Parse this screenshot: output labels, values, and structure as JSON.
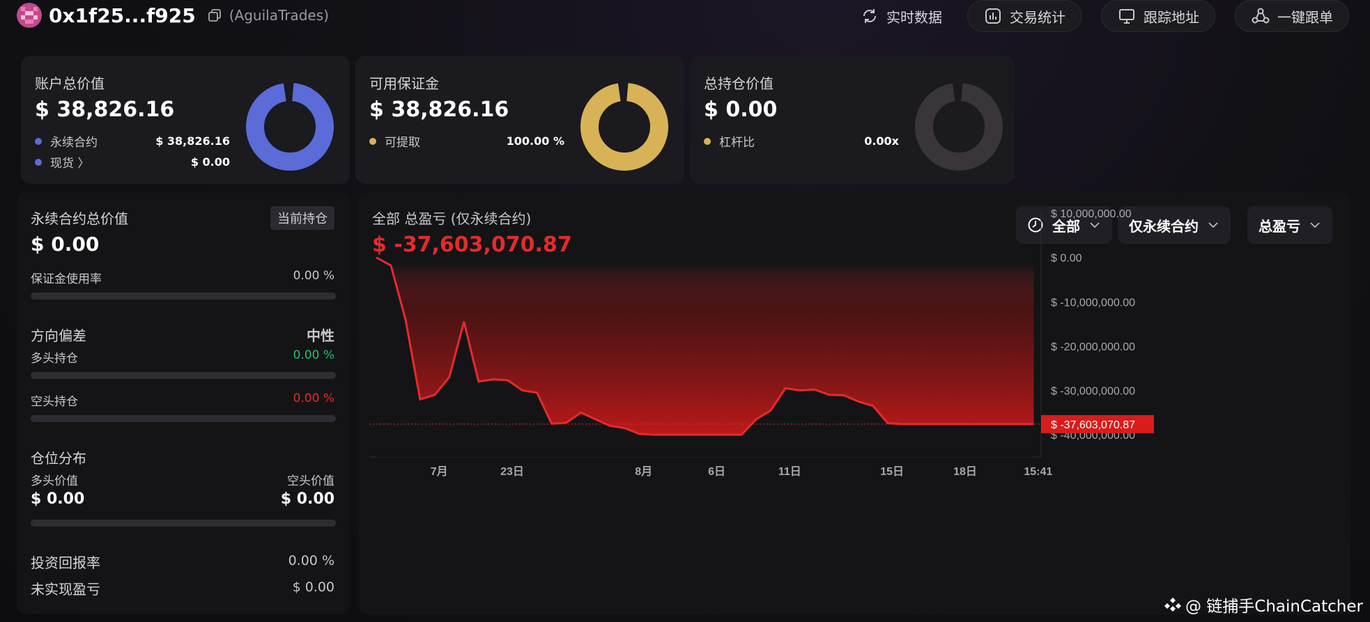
{
  "header": {
    "address": "0x1f25...f925",
    "alias": "(AguilaTrades)",
    "buttons": [
      {
        "label": "实时数据",
        "icon": "refresh-icon"
      },
      {
        "label": "交易统计",
        "icon": "stats-icon"
      },
      {
        "label": "跟踪地址",
        "icon": "monitor-icon"
      },
      {
        "label": "一键跟单",
        "icon": "network-icon"
      }
    ]
  },
  "cards": {
    "account": {
      "title": "账户总价值",
      "value": "$ 38,826.16",
      "rows": [
        {
          "label": "永续合约",
          "value": "$ 38,826.16",
          "color": "#5b6bd8"
        },
        {
          "label": "现货 〉",
          "value": "$ 0.00",
          "color": "#5b6bd8"
        }
      ],
      "donut_color": "#5b6bd8",
      "donut_fraction": 1.0
    },
    "margin": {
      "title": "可用保证金",
      "value": "$ 38,826.16",
      "rows": [
        {
          "label": "可提取",
          "value": "100.00 %",
          "color": "#d8b256"
        }
      ],
      "donut_color": "#d8b256",
      "donut_fraction": 1.0
    },
    "position": {
      "title": "总持仓价值",
      "value": "$ 0.00",
      "rows": [
        {
          "label": "杠杆比",
          "value": "0.00x",
          "color": "#d8b256"
        }
      ],
      "donut_color": "#3a3538",
      "donut_fraction": 1.0
    }
  },
  "left_panel": {
    "title": "永续合约总价值",
    "tag": "当前持仓",
    "value": "$ 0.00",
    "margin_usage_label": "保证金使用率",
    "margin_usage_value": "0.00 %",
    "margin_usage_fraction": 0,
    "bias_label": "方向偏差",
    "bias_value": "中性",
    "long_label": "多头持仓",
    "long_value": "0.00 %",
    "long_color": "#23c26a",
    "short_label": "空头持仓",
    "short_value": "0.00 %",
    "short_color": "#e42b2b",
    "distribution_label": "仓位分布",
    "long_val_label": "多头价值",
    "short_val_label": "空头价值",
    "long_val": "$ 0.00",
    "short_val": "$ 0.00",
    "roi_label": "投资回报率",
    "roi_value": "0.00 %",
    "unrealized_label": "未实现盈亏",
    "unrealized_value": "$ 0.00"
  },
  "chart_panel": {
    "title": "全部 总盈亏 (仅永续合约)",
    "value": "$ -37,603,070.87",
    "dropdowns": [
      {
        "label": "全部",
        "icon": "clock-icon"
      },
      {
        "label": "仅永续合约",
        "icon": ""
      },
      {
        "label": "总盈亏",
        "icon": ""
      }
    ]
  },
  "chart_data": {
    "type": "area",
    "ylim": [
      -45000000,
      10000000
    ],
    "y_ticks": [
      10000000,
      0,
      -10000000,
      -20000000,
      -30000000,
      -40000000
    ],
    "y_tick_labels": [
      "$ 10,000,000.00",
      "$ 0.00",
      "$ -10,000,000.00",
      "$ -20,000,000.00",
      "$ -30,000,000.00",
      "$ -40,000,000.00"
    ],
    "x_tick_labels": [
      "7月",
      "23日",
      "8月",
      "6日",
      "11日",
      "15日",
      "18日",
      "15:41"
    ],
    "x_tick_positions": [
      4.3,
      9.3,
      18.3,
      23.3,
      28.3,
      35.3,
      40.3,
      45.3
    ],
    "x_max": 45.5,
    "x": [
      0,
      1,
      2,
      3,
      4,
      5,
      6,
      7,
      8,
      9,
      10,
      11,
      12,
      13,
      14,
      15,
      16,
      17,
      18,
      19,
      20,
      21,
      22,
      23,
      24,
      25,
      26,
      27,
      28,
      29,
      30,
      31,
      32,
      33,
      34,
      35,
      36,
      37,
      38,
      39,
      40,
      41,
      42,
      43,
      44,
      45
    ],
    "values": [
      0,
      -1800000,
      -14000000,
      -32000000,
      -31000000,
      -27000000,
      -14500000,
      -28000000,
      -27500000,
      -27700000,
      -30000000,
      -30500000,
      -37500000,
      -37300000,
      -35000000,
      -36500000,
      -38000000,
      -38500000,
      -39800000,
      -40000000,
      -40000000,
      -40000000,
      -40000000,
      -40000000,
      -40000000,
      -40000000,
      -36500000,
      -34500000,
      -29500000,
      -30000000,
      -29800000,
      -31000000,
      -31100000,
      -32500000,
      -33500000,
      -37400000,
      -37600000,
      -37600000,
      -37600000,
      -37600000,
      -37600000,
      -37600000,
      -37600000,
      -37600000,
      -37600000,
      -37603070.87
    ],
    "current_label": "$ -37,603,070.87",
    "current_value": -37603070.87,
    "line_color": "#e42b2b",
    "grid": false
  },
  "watermark": "@ 链捕手ChainCatcher"
}
